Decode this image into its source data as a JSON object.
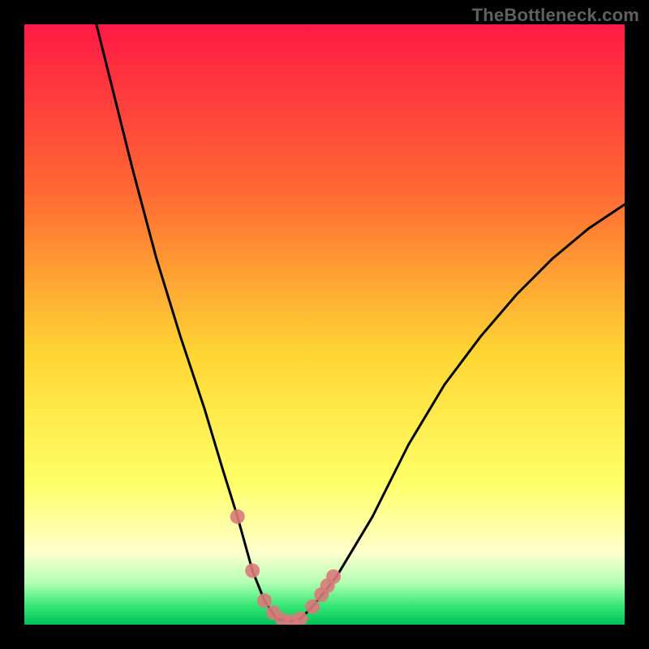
{
  "watermark": "TheBottleneck.com",
  "colors": {
    "frame": "#000000",
    "gradient_top": "#ff1a45",
    "gradient_mid_upper": "#ff6a33",
    "gradient_mid": "#ffd633",
    "gradient_lower": "#ffff66",
    "gradient_pale": "#ffffcc",
    "gradient_green_pale": "#b3ffb3",
    "gradient_green": "#33e673",
    "gradient_green_deep": "#00c057",
    "curve": "#000000",
    "marker": "#d97a7a"
  },
  "chart_data": {
    "type": "line",
    "title": "",
    "xlabel": "",
    "ylabel": "",
    "xlim": [
      0,
      100
    ],
    "ylim": [
      0,
      100
    ],
    "note": "Axes are unlabeled; values are normalized 0–100 estimated from pixel positions. Lower y = better (green zone at bottom).",
    "series": [
      {
        "name": "bottleneck-curve",
        "x": [
          12,
          14,
          18,
          22,
          26,
          30,
          33,
          35.5,
          38,
          40,
          42,
          44,
          46,
          48,
          52,
          58,
          64,
          70,
          76,
          82,
          88,
          94,
          100
        ],
        "y": [
          100,
          92,
          76,
          61,
          48,
          36,
          26,
          18,
          9,
          4,
          1,
          0.5,
          1,
          3,
          8,
          18,
          30,
          40,
          48,
          55,
          61,
          66,
          70
        ]
      }
    ],
    "markers": {
      "name": "highlighted-points",
      "x": [
        35.5,
        38,
        40,
        41.5,
        43,
        44.5,
        46,
        48,
        49.5,
        50.5,
        51.5
      ],
      "y": [
        18,
        9,
        4,
        2,
        0.8,
        0.5,
        1,
        3,
        5,
        6.5,
        8
      ]
    },
    "optimal_zone_y": [
      0,
      6
    ]
  }
}
